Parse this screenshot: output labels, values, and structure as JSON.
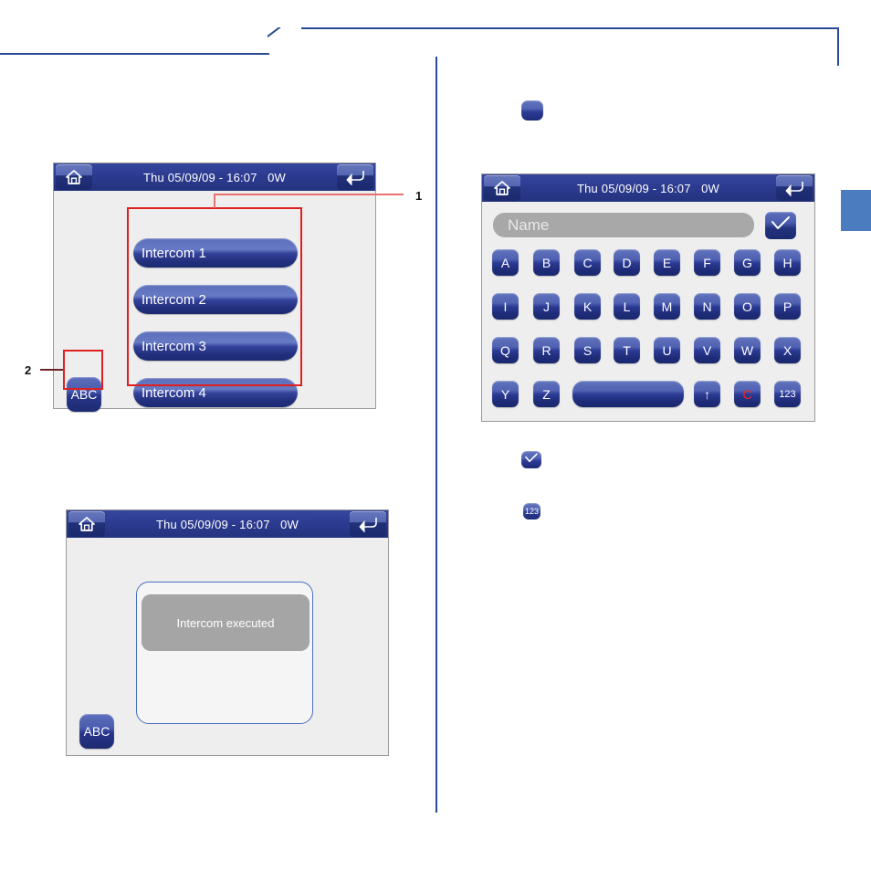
{
  "decor": {
    "callout_1": "1",
    "callout_2": "2"
  },
  "screens": {
    "intercom_list": {
      "titlebar": {
        "title": "Thu 05/09/09 - 16:07   0W",
        "home_icon": "home-icon",
        "back_icon": "return-arrow-icon"
      },
      "buttons": [
        {
          "label": "Intercom 1"
        },
        {
          "label": "Intercom 2"
        },
        {
          "label": "Intercom 3"
        },
        {
          "label": "Intercom 4"
        }
      ],
      "abc_key": "ABC"
    },
    "message": {
      "titlebar": {
        "title": "Thu 05/09/09 - 16:07   0W",
        "home_icon": "home-icon",
        "back_icon": "return-arrow-icon"
      },
      "message_text": "Intercom executed",
      "abc_key": "ABC"
    },
    "keyboard": {
      "titlebar": {
        "title": "Thu 05/09/09 - 16:07   0W",
        "home_icon": "home-icon",
        "back_icon": "return-arrow-icon"
      },
      "name_field": {
        "value": "",
        "placeholder": "Name"
      },
      "confirm_icon": "checkmark-icon",
      "rows": [
        [
          "A",
          "B",
          "C",
          "D",
          "E",
          "F",
          "G",
          "H"
        ],
        [
          "I",
          "J",
          "K",
          "L",
          "M",
          "N",
          "O",
          "P"
        ],
        [
          "Q",
          "R",
          "S",
          "T",
          "U",
          "V",
          "W",
          "X"
        ]
      ],
      "last_row": {
        "y": "Y",
        "z": "Z",
        "space": "",
        "shift": "↑",
        "clear": "C",
        "numeric": "123"
      }
    }
  },
  "icon_samples": {
    "blank_key": "",
    "check_key": "checkmark-icon",
    "numeric_key": "123"
  },
  "colors": {
    "rule": "#2a4a93",
    "titlebar": "#2b3f96",
    "key_top": "#6274bd",
    "key_bottom": "#1a2770",
    "screen_bg": "#eeeeee",
    "callout_red": "#e02020",
    "msg_gray": "#a5a5a5",
    "edge_tab": "#4b7cc0"
  }
}
